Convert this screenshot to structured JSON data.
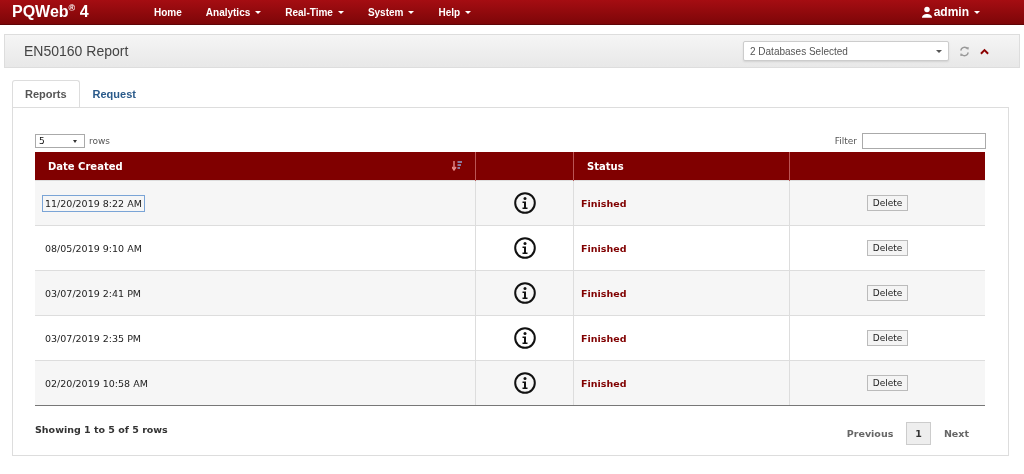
{
  "navbar": {
    "brand": "PQWeb$^{®}$ 4",
    "menu": [
      {
        "label": "Home",
        "dropdown": false
      },
      {
        "label": "Analytics",
        "dropdown": true
      },
      {
        "label": "Real-Time",
        "dropdown": true
      },
      {
        "label": "System",
        "dropdown": true
      },
      {
        "label": "Help",
        "dropdown": true
      }
    ],
    "user": "admin"
  },
  "panel": {
    "title": "EN50160 Report",
    "database_select": "2 Databases Selected"
  },
  "tabs": [
    {
      "label": "Reports",
      "selected": true
    },
    {
      "label": "Request",
      "selected": false
    }
  ],
  "page_size": {
    "value": "5",
    "label": "rows"
  },
  "filter": {
    "label": "Filter"
  },
  "table": {
    "columns": [
      "Date Created",
      "Status"
    ],
    "rows": [
      {
        "date": "11/20/2019 8:22 AM",
        "focused": true,
        "status": "Finished",
        "action": "Delete"
      },
      {
        "date": "08/05/2019 9:10 AM",
        "focused": false,
        "status": "Finished",
        "action": "Delete"
      },
      {
        "date": "03/07/2019 2:41 PM",
        "focused": false,
        "status": "Finished",
        "action": "Delete"
      },
      {
        "date": "03/07/2019 2:35 PM",
        "focused": false,
        "status": "Finished",
        "action": "Delete"
      },
      {
        "date": "02/20/2019 10:58 AM",
        "focused": false,
        "status": "Finished",
        "action": "Delete"
      }
    ]
  },
  "footer": {
    "summary": "Showing 1 to 5 of 5 rows",
    "pagination": [
      {
        "label": "Previous",
        "selected": false
      },
      {
        "label": "1",
        "selected": true
      },
      {
        "label": "Next",
        "selected": false
      }
    ]
  }
}
